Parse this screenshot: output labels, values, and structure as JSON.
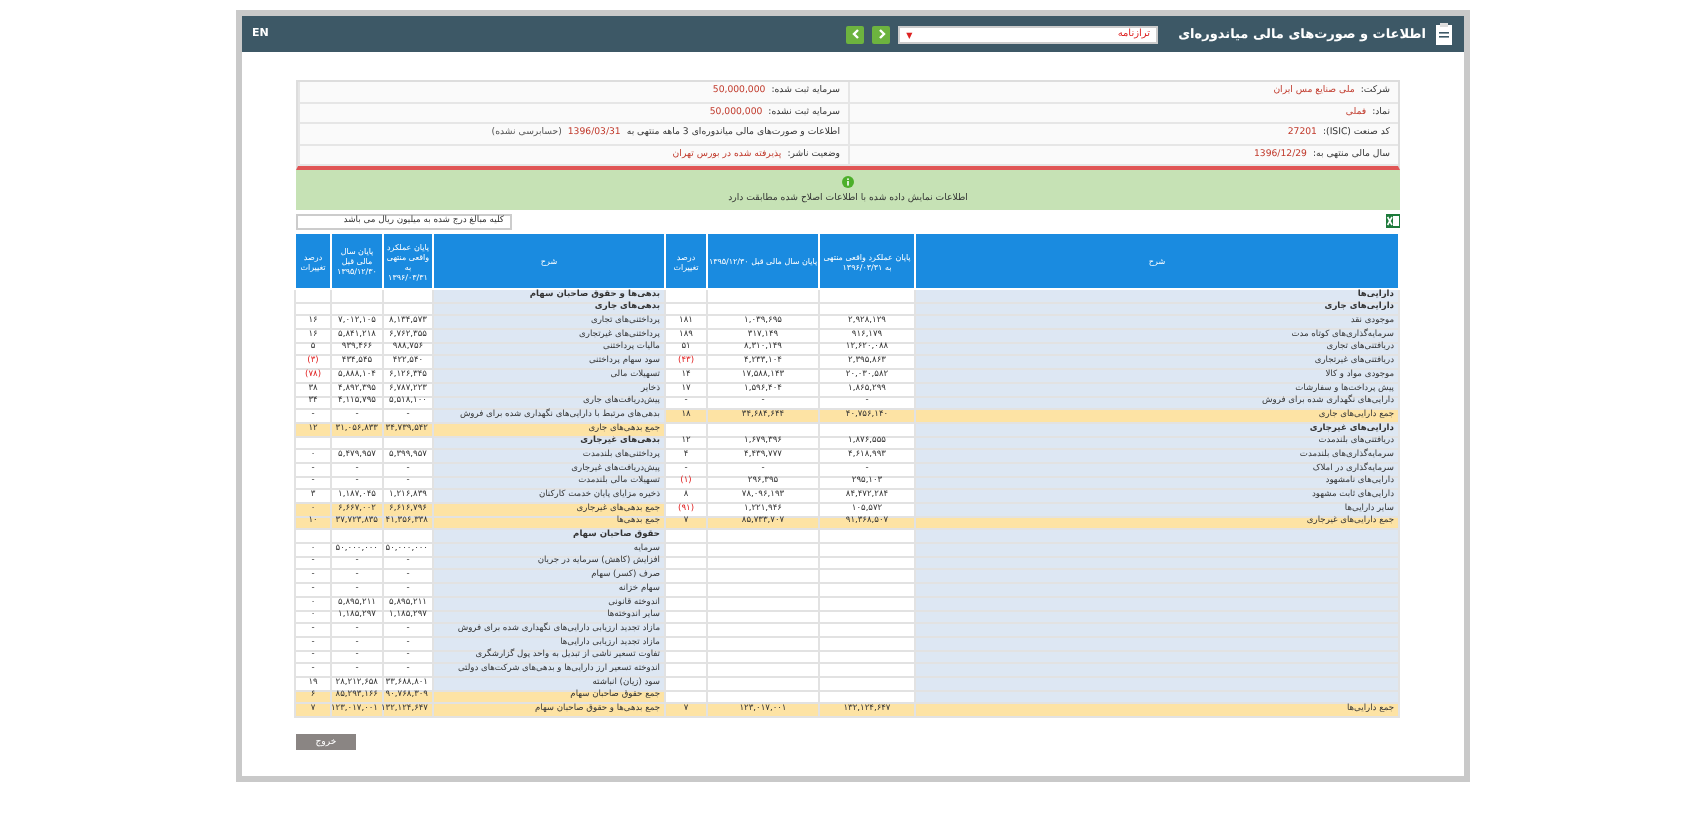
{
  "window": {
    "title": "اطلاعات و صورت‌های مالی میاندوره‌ای",
    "report_select": {
      "value": "ترازنامه",
      "caret": "▼"
    },
    "language_link": "EN"
  },
  "info": [
    {
      "label": "شرکت:",
      "value": "ملی صنایع مس ایران"
    },
    {
      "label": "سرمایه ثبت شده:",
      "value": "50,000,000"
    },
    {
      "label": "نماد:",
      "value": "فملی"
    },
    {
      "label": "سرمایه ثبت نشده:",
      "value": "50,000,000"
    },
    {
      "label": "کد صنعت (ISIC):",
      "value": "27201"
    },
    {
      "label": "اطلاعات و صورت‌های مالی میاندوره‌ای 3 ماهه منتهی به",
      "value": "1396/03/31",
      "note": "(حسابرسی نشده)"
    },
    {
      "label": "سال مالی منتهی به:",
      "value": "1396/12/29"
    },
    {
      "label": "وضعیت ناشر:",
      "value": "پذیرفته شده در بورس تهران"
    }
  ],
  "notice": "اطلاعات نمایش داده شده با اطلاعات اصلاح شده مطابقت دارد",
  "units_note": "کلیه مبالغ درج شده به میلیون ریال می باشد",
  "table": {
    "columns": [
      "شرح",
      "پایان عملکرد واقعی منتهی به ۱۳۹۶/۰۳/۳۱",
      "پایان سال مالی قبل ۱۳۹۵/۱۲/۳۰",
      "درصد تغییرات",
      "شرح",
      "پایان عملکرد واقعی منتهی به ۱۳۹۶/۰۳/۳۱",
      "پایان سال مالی قبل ۱۳۹۵/۱۲/۳۰",
      "درصد تغییرات"
    ],
    "rows": [
      {
        "assets": {
          "kind": "heading",
          "label": "دارایی‌ها"
        },
        "liabilities": {
          "kind": "heading",
          "label": "بدهی‌ها و حقوق صاحبان سهام"
        }
      },
      {
        "assets": {
          "kind": "heading",
          "label": "دارایی‌های جاری"
        },
        "liabilities": {
          "kind": "heading",
          "label": "بدهی‌های جاری"
        }
      },
      {
        "assets": {
          "kind": "item",
          "label": "موجودی نقد",
          "current": "۲,۹۲۸,۱۲۹",
          "prior": "۱,۰۳۹,۶۹۵",
          "change": "۱۸۱",
          "negative": false
        },
        "liabilities": {
          "kind": "item",
          "label": "پرداختنی‌های تجاری",
          "current": "۸,۱۳۴,۵۷۳",
          "prior": "۷,۰۱۲,۱۰۵",
          "change": "۱۶",
          "negative": false
        }
      },
      {
        "assets": {
          "kind": "item",
          "label": "سرمایه‌گذاری‌های کوتاه مدت",
          "current": "۹۱۶,۱۷۹",
          "prior": "۳۱۷,۱۴۹",
          "change": "۱۸۹",
          "negative": false
        },
        "liabilities": {
          "kind": "item",
          "label": "پرداختنی‌های غیرتجاری",
          "current": "۶,۷۶۲,۳۵۵",
          "prior": "۵,۸۴۱,۲۱۸",
          "change": "۱۶",
          "negative": false
        }
      },
      {
        "assets": {
          "kind": "item",
          "label": "دریافتنی‌های تجاری",
          "current": "۱۲,۶۲۰,۰۸۸",
          "prior": "۸,۳۱۰,۱۴۹",
          "change": "۵۱",
          "negative": false
        },
        "liabilities": {
          "kind": "item",
          "label": "مالیات پرداختنی",
          "current": "۹۸۸,۷۵۶",
          "prior": "۹۳۹,۴۶۶",
          "change": "۵",
          "negative": false
        }
      },
      {
        "assets": {
          "kind": "item",
          "label": "دریافتنی‌های غیرتجاری",
          "current": "۲,۳۹۵,۸۶۳",
          "prior": "۴,۲۳۳,۱۰۴",
          "change": "(۴۳)",
          "negative": true
        },
        "liabilities": {
          "kind": "item",
          "label": "سود سهام پرداختنی",
          "current": "۴۲۲,۵۴۰",
          "prior": "۴۳۴,۵۴۵",
          "change": "(۳)",
          "negative": true
        }
      },
      {
        "assets": {
          "kind": "item",
          "label": "موجودی مواد و کالا",
          "current": "۲۰,۰۳۰,۵۸۲",
          "prior": "۱۷,۵۸۸,۱۴۳",
          "change": "۱۴",
          "negative": false
        },
        "liabilities": {
          "kind": "item",
          "label": "تسهیلات مالی",
          "current": "۶,۱۲۶,۳۴۵",
          "prior": "۵,۸۸۸,۱۰۴",
          "change": "(۷۸)",
          "negative": true
        }
      },
      {
        "assets": {
          "kind": "item",
          "label": "پیش پرداخت‌ها و سفارشات",
          "current": "۱,۸۶۵,۲۹۹",
          "prior": "۱,۵۹۶,۴۰۴",
          "change": "۱۷",
          "negative": false
        },
        "liabilities": {
          "kind": "item",
          "label": "ذخایر",
          "current": "۶,۷۸۷,۲۲۳",
          "prior": "۴,۸۹۲,۳۹۵",
          "change": "۳۸",
          "negative": false
        }
      },
      {
        "assets": {
          "kind": "item",
          "label": "دارایی‌های نگهداری شده برای فروش",
          "current": "-",
          "prior": "-",
          "change": "-",
          "negative": false
        },
        "liabilities": {
          "kind": "item",
          "label": "پیش‌دریافت‌های جاری",
          "current": "۵,۵۱۸,۱۰۰",
          "prior": "۴,۱۱۵,۷۹۵",
          "change": "۳۴",
          "negative": false
        }
      },
      {
        "assets": {
          "kind": "total",
          "label": "جمع دارایی‌های جاری",
          "current": "۴۰,۷۵۶,۱۴۰",
          "prior": "۳۴,۶۸۴,۶۴۴",
          "change": "۱۸",
          "negative": false
        },
        "liabilities": {
          "kind": "item",
          "label": "بدهی‌های مرتبط با دارایی‌های نگهداری شده برای فروش",
          "current": "-",
          "prior": "-",
          "change": "-",
          "negative": false
        }
      },
      {
        "assets": {
          "kind": "heading",
          "label": "دارایی‌های غیرجاری"
        },
        "liabilities": {
          "kind": "total",
          "label": "جمع بدهی‌های جاری",
          "current": "۳۴,۷۳۹,۵۴۲",
          "prior": "۳۱,۰۵۶,۸۳۳",
          "change": "۱۲",
          "negative": false
        }
      },
      {
        "assets": {
          "kind": "item",
          "label": "دریافتنی‌های بلندمدت",
          "current": "۱,۸۷۶,۵۵۵",
          "prior": "۱,۶۷۹,۳۹۶",
          "change": "۱۲",
          "negative": false
        },
        "liabilities": {
          "kind": "heading",
          "label": "بدهی‌های غیرجاری"
        }
      },
      {
        "assets": {
          "kind": "item",
          "label": "سرمایه‌گذاری‌های بلندمدت",
          "current": "۴,۶۱۸,۹۹۳",
          "prior": "۴,۴۳۹,۷۷۷",
          "change": "۴",
          "negative": false
        },
        "liabilities": {
          "kind": "item",
          "label": "پرداختنی‌های بلندمدت",
          "current": "۵,۳۹۹,۹۵۷",
          "prior": "۵,۴۷۹,۹۵۷",
          "change": "۰"
        }
      },
      {
        "assets": {
          "kind": "item",
          "label": "سرمایه‌گذاری در املاک",
          "current": "-",
          "prior": "-",
          "change": "-",
          "negative": false
        },
        "liabilities": {
          "kind": "item",
          "label": "پیش‌دریافت‌های غیرجاری",
          "current": "-",
          "prior": "-",
          "change": "-",
          "negative": false
        }
      },
      {
        "assets": {
          "kind": "item",
          "label": "دارایی‌های نامشهود",
          "current": "۲۹۵,۱۰۳",
          "prior": "۲۹۶,۳۹۵",
          "change": "(۱)",
          "negative": true
        },
        "liabilities": {
          "kind": "item",
          "label": "تسهیلات مالی بلندمدت",
          "current": "-",
          "prior": "-",
          "change": "-",
          "negative": false
        }
      },
      {
        "assets": {
          "kind": "item",
          "label": "دارایی‌های ثابت مشهود",
          "current": "۸۴,۴۷۲,۲۸۴",
          "prior": "۷۸,۰۹۶,۱۹۳",
          "change": "۸",
          "negative": false
        },
        "liabilities": {
          "kind": "item",
          "label": "ذخیره مزایای پایان خدمت کارکنان",
          "current": "۱,۲۱۶,۸۳۹",
          "prior": "۱,۱۸۷,۰۴۵",
          "change": "۳",
          "negative": false
        }
      },
      {
        "assets": {
          "kind": "item",
          "label": "سایر دارایی‌ها",
          "current": "۱۰۵,۵۷۲",
          "prior": "۱,۲۲۱,۹۴۶",
          "change": "(۹۱)",
          "negative": true
        },
        "liabilities": {
          "kind": "total",
          "label": "جمع بدهی‌های غیرجاری",
          "current": "۶,۶۱۶,۷۹۶",
          "prior": "۶,۶۶۷,۰۰۲",
          "change": "۰"
        }
      },
      {
        "assets": {
          "kind": "total",
          "label": "جمع دارایی‌های غیرجاری",
          "current": "۹۱,۳۶۸,۵۰۷",
          "prior": "۸۵,۷۳۳,۷۰۷",
          "change": "۷",
          "negative": false
        },
        "liabilities": {
          "kind": "total",
          "label": "جمع بدهی‌ها",
          "current": "۴۱,۳۵۶,۳۳۸",
          "prior": "۳۷,۷۲۳,۸۳۵",
          "change": "۱۰",
          "negative": false
        }
      },
      {
        "assets": {
          "kind": "blank"
        },
        "liabilities": {
          "kind": "heading",
          "label": "حقوق صاحبان سهام"
        }
      },
      {
        "assets": {
          "kind": "blank"
        },
        "liabilities": {
          "kind": "item",
          "label": "سرمایه",
          "current": "۵۰,۰۰۰,۰۰۰",
          "prior": "۵۰,۰۰۰,۰۰۰",
          "change": "۰"
        }
      },
      {
        "assets": {
          "kind": "blank"
        },
        "liabilities": {
          "kind": "item",
          "label": "افزایش (کاهش) سرمایه در جریان",
          "current": "-",
          "prior": "-",
          "change": "-",
          "negative": false
        }
      },
      {
        "assets": {
          "kind": "blank"
        },
        "liabilities": {
          "kind": "item",
          "label": "صرف (کسر) سهام",
          "current": "-",
          "prior": "-",
          "change": "-",
          "negative": false
        }
      },
      {
        "assets": {
          "kind": "blank"
        },
        "liabilities": {
          "kind": "item",
          "label": "سهام خزانه",
          "current": "-",
          "prior": "-",
          "change": "-",
          "negative": false
        }
      },
      {
        "assets": {
          "kind": "blank"
        },
        "liabilities": {
          "kind": "item",
          "label": "اندوخته قانونی",
          "current": "۵,۸۹۵,۲۱۱",
          "prior": "۵,۸۹۵,۲۱۱",
          "change": "۰"
        }
      },
      {
        "assets": {
          "kind": "blank"
        },
        "liabilities": {
          "kind": "item",
          "label": "سایر اندوخته‌ها",
          "current": "۱,۱۸۵,۲۹۷",
          "prior": "۱,۱۸۵,۲۹۷",
          "change": "۰"
        }
      },
      {
        "assets": {
          "kind": "blank"
        },
        "liabilities": {
          "kind": "item",
          "label": "مازاد تجدید ارزیابی دارایی‌های نگهداری شده برای فروش",
          "current": "-",
          "prior": "-",
          "change": "-",
          "negative": false
        }
      },
      {
        "assets": {
          "kind": "blank"
        },
        "liabilities": {
          "kind": "item",
          "label": "مازاد تجدید ارزیابی دارایی‌ها",
          "current": "-",
          "prior": "-",
          "change": "-",
          "negative": false
        }
      },
      {
        "assets": {
          "kind": "blank"
        },
        "liabilities": {
          "kind": "item",
          "label": "تفاوت تسعیر ناشی از تبدیل به واحد پول گزارشگری",
          "current": "-",
          "prior": "-",
          "change": "-",
          "negative": false
        }
      },
      {
        "assets": {
          "kind": "blank"
        },
        "liabilities": {
          "kind": "item",
          "label": "اندوخته تسعیر ارز دارایی‌ها و بدهی‌های شرکت‌های دولتی",
          "current": "-",
          "prior": "-",
          "change": "-",
          "negative": false
        }
      },
      {
        "assets": {
          "kind": "blank"
        },
        "liabilities": {
          "kind": "item",
          "label": "سود (زیان) انباشته",
          "current": "۳۳,۶۸۸,۸۰۱",
          "prior": "۲۸,۲۱۲,۶۵۸",
          "change": "۱۹",
          "negative": false
        }
      },
      {
        "assets": {
          "kind": "blank"
        },
        "liabilities": {
          "kind": "total",
          "label": "جمع حقوق صاحبان سهام",
          "current": "۹۰,۷۶۸,۳۰۹",
          "prior": "۸۵,۲۹۳,۱۶۶",
          "change": "۶",
          "negative": false
        }
      },
      {
        "assets": {
          "kind": "total",
          "label": "جمع دارایی‌ها",
          "current": "۱۳۲,۱۲۴,۶۴۷",
          "prior": "۱۲۳,۰۱۷,۰۰۱",
          "change": "۷",
          "negative": false
        },
        "liabilities": {
          "kind": "total",
          "label": "جمع بدهی‌ها و حقوق صاحبان سهام",
          "current": "۱۳۲,۱۲۴,۶۴۷",
          "prior": "۱۲۳,۰۱۷,۰۰۱",
          "change": "۷",
          "negative": false
        }
      }
    ]
  },
  "exit_button": "خروج"
}
